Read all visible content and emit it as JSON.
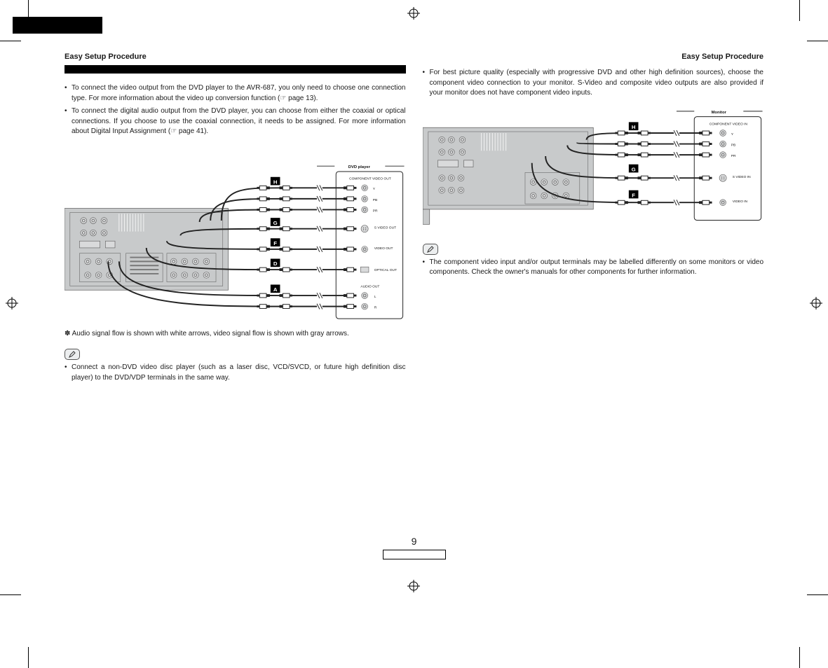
{
  "page": {
    "number": "9",
    "masthead_label": ""
  },
  "left_column": {
    "section_title": "Easy Setup Procedure",
    "bullets": [
      "To connect the video output from the DVD player to the AVR-687, you only need to choose one connection type. For more information about the video up conversion function (☞ page 13).",
      "To connect the digital audio output from the DVD player, you can choose from either the coaxial or optical connections. If you choose to use the coaxial connection, it needs to be assigned. For more information about Digital Input Assignment (☞ page 41)."
    ],
    "diagram": {
      "device_title": "DVD player",
      "port_header": "COMPONENT VIDEO OUT",
      "audio_header": "AUDIO OUT",
      "ports": {
        "y": "Y",
        "pb": "PB",
        "pr": "PR",
        "svideo": "S VIDEO OUT",
        "video": "VIDEO OUT",
        "optical": "OPTICAL OUT",
        "l": "L",
        "r": "R"
      },
      "tags": {
        "h": "H",
        "g": "G",
        "f": "F",
        "d": "D",
        "a": "A"
      }
    },
    "footnote": "Audio signal flow is shown with white arrows, video signal flow is shown with gray arrows.",
    "note_bullet": "Connect a non-DVD video disc player (such as a laser disc, VCD/SVCD, or future high definition disc player) to the DVD/VDP terminals in the same way."
  },
  "right_column": {
    "section_title": "Easy Setup Procedure",
    "bullets": [
      "For best picture quality (especially with progressive DVD and other high definition sources), choose the component video connection to your monitor. S-Video and composite video outputs are also provided if your monitor does not have component video inputs."
    ],
    "diagram": {
      "device_title": "Monitor",
      "port_header": "COMPONENT VIDEO IN",
      "ports": {
        "y": "Y",
        "pb": "PB",
        "pr": "PR",
        "svideo": "S VIDEO IN",
        "video": "VIDEO IN"
      },
      "tags": {
        "h": "H",
        "g": "G",
        "f": "F"
      }
    },
    "note_bullet": "The component video input and/or output terminals may be labelled differently on some monitors or video components. Check the owner's manuals for other components for further information."
  }
}
